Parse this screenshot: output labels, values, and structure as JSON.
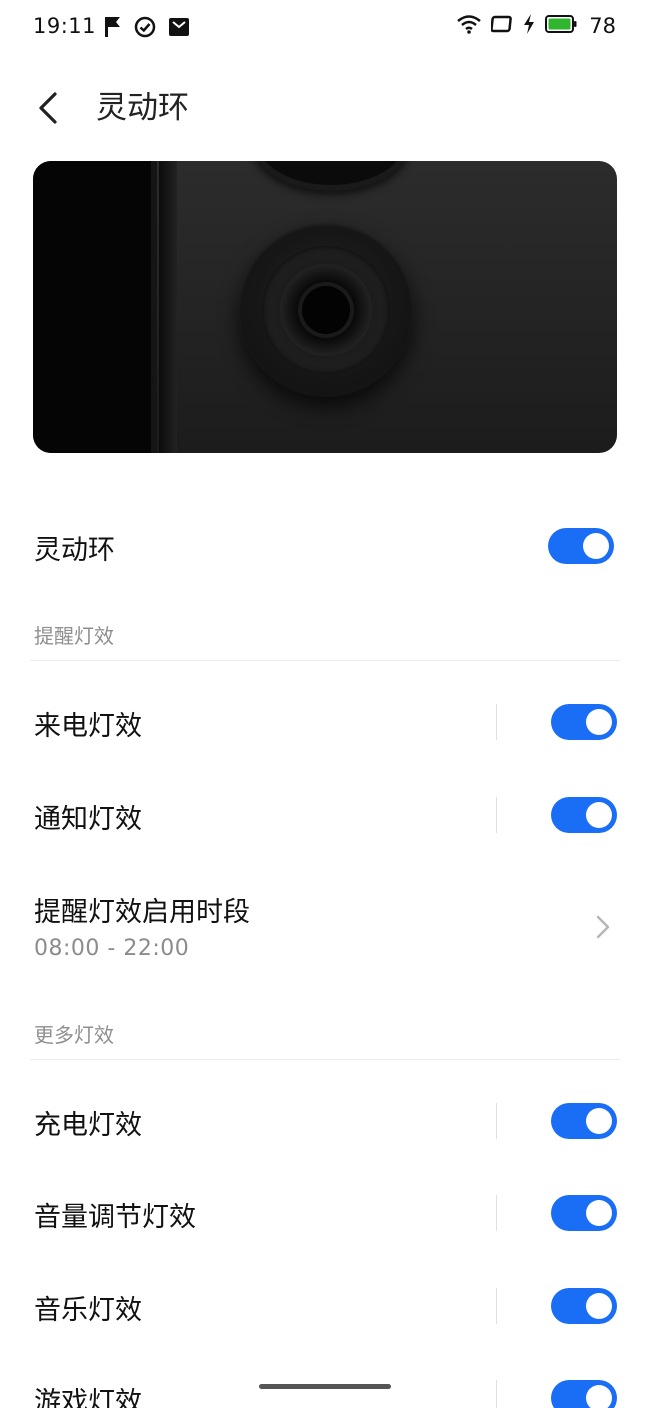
{
  "status_bar": {
    "time": "19:11",
    "battery_level": "78",
    "left_icons": [
      "flag-icon",
      "check-circle-icon",
      "mail-icon"
    ],
    "right_icons": [
      "wifi-icon",
      "screen-icon",
      "charging-bolt-icon",
      "battery-icon"
    ],
    "battery_color": "#2fb52f"
  },
  "header": {
    "back_icon": "chevron-left-icon",
    "title": "灵动环"
  },
  "main_toggle": {
    "label": "灵动环",
    "enabled": true
  },
  "sections": [
    {
      "title": "提醒灯效",
      "items": [
        {
          "label": "来电灯效",
          "type": "toggle",
          "enabled": true
        },
        {
          "label": "通知灯效",
          "type": "toggle",
          "enabled": true
        },
        {
          "label": "提醒灯效启用时段",
          "type": "link",
          "value": "08:00 - 22:00"
        }
      ]
    },
    {
      "title": "更多灯效",
      "items": [
        {
          "label": "充电灯效",
          "type": "toggle",
          "enabled": true
        },
        {
          "label": "音量调节灯效",
          "type": "toggle",
          "enabled": true
        },
        {
          "label": "音乐灯效",
          "type": "toggle",
          "enabled": true
        },
        {
          "label": "游戏灯效",
          "type": "toggle",
          "enabled": true
        }
      ]
    }
  ],
  "colors": {
    "accent": "#1a6ef5",
    "section_title": "#8f8f8f",
    "subtext": "#8c8c8c"
  }
}
